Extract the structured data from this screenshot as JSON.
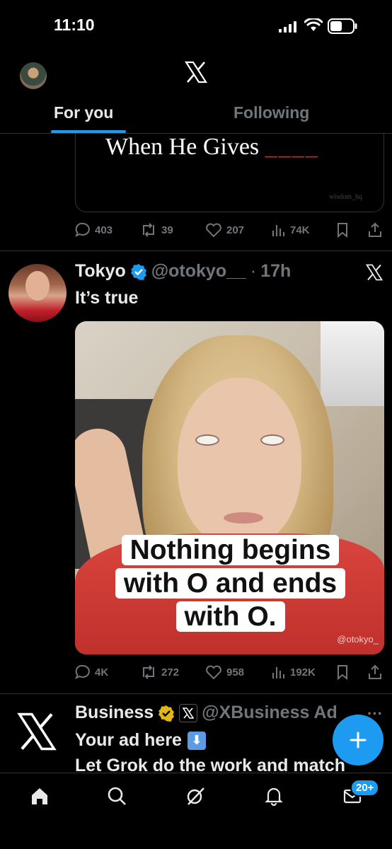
{
  "status_bar": {
    "time": "11:10"
  },
  "header": {
    "tabs": [
      {
        "label": "For you",
        "active": true
      },
      {
        "label": "Following",
        "active": false
      }
    ]
  },
  "previous_tweet": {
    "image_text": "When He Gives",
    "image_blanks": "____",
    "watermark": "wisdom_hq",
    "stats": {
      "replies": "403",
      "reposts": "39",
      "likes": "207",
      "views": "74K"
    }
  },
  "tweet": {
    "name": "Tokyo",
    "handle": "@otokyo__",
    "separator": "·",
    "time": "17h",
    "text": "It’s true",
    "media": {
      "caption_lines": [
        "Nothing begins",
        "with O and ends",
        "with O."
      ],
      "watermark": "@otokyo_"
    },
    "stats": {
      "replies": "4K",
      "reposts": "272",
      "likes": "958",
      "views": "192K"
    }
  },
  "ad": {
    "name": "Business",
    "handle": "@XBusiness",
    "label": "Ad",
    "more": "···",
    "line1": "Your ad here",
    "line1_emoji": "⬇",
    "line2": "Let Grok do the work and match"
  },
  "tab_bar": {
    "items": [
      "home-icon",
      "search-icon",
      "grok-icon",
      "notifications-icon",
      "messages-icon"
    ],
    "messages_badge": "20+"
  },
  "colors": {
    "accent": "#1d9bf0",
    "background": "#000000",
    "muted": "#71767b"
  }
}
